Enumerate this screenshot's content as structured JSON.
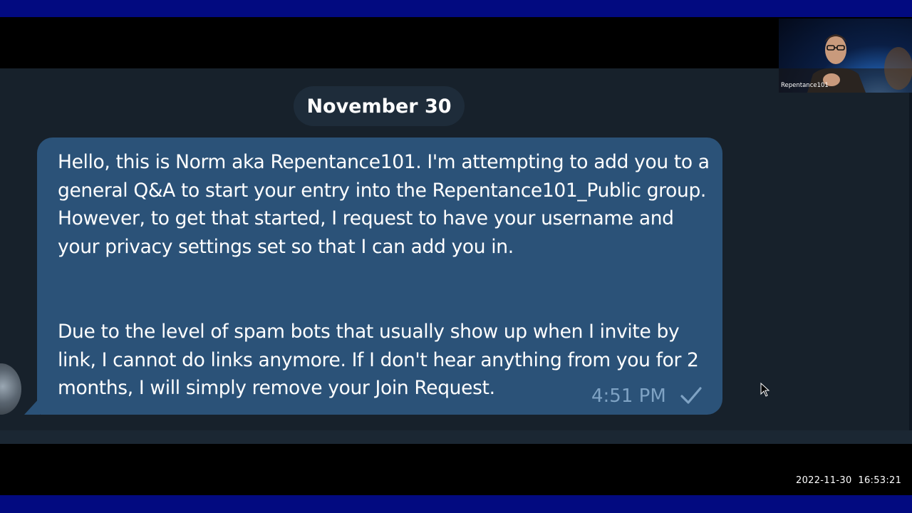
{
  "date_separator": "November 30",
  "message": {
    "paragraph_1": "Hello, this is Norm aka Repentance101. I'm attempting to add you to a general Q&A to start your entry into the Repentance101_Public group. However, to get that started, I request to have your username and your privacy settings set so that I can add you in.",
    "paragraph_2": "Due to the level of spam bots that usually show up when I invite by link, I cannot do links anymore. If I don't hear anything from you for 2 months, I will simply remove your Join Request.",
    "time": "4:51 PM",
    "status_icon": "single-check-icon"
  },
  "webcam": {
    "label": "Repentance101"
  },
  "recording_timestamp": "2022-11-30  16:53:21",
  "colors": {
    "bubble": "#2b5278",
    "chat_background": "#17212b",
    "border_bars": "#020a80",
    "time_text": "#7fa3c4"
  }
}
